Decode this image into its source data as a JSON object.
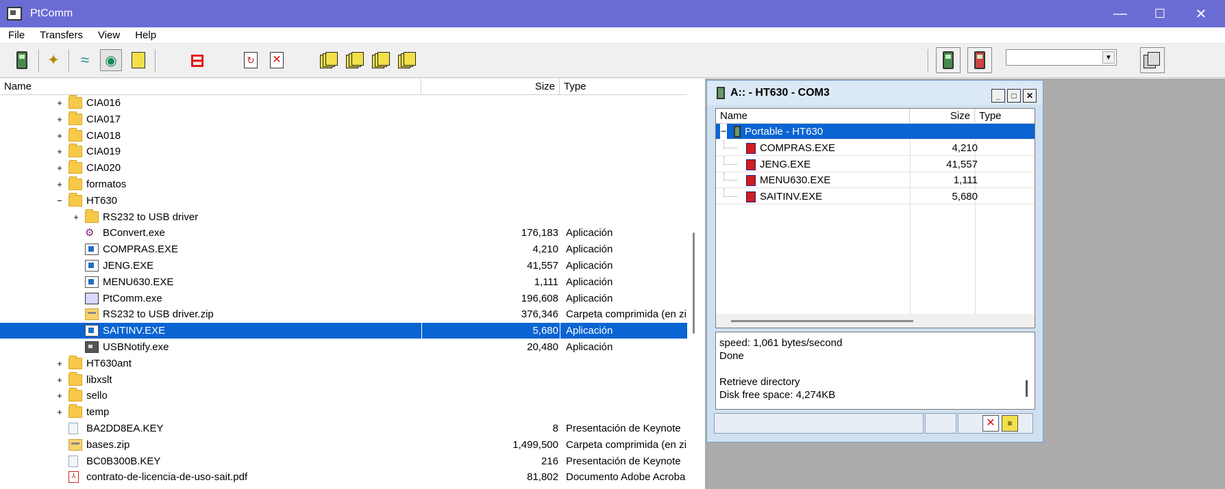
{
  "window": {
    "title": "PtComm",
    "minimize": "—",
    "maximize": "☐",
    "close": "✕"
  },
  "menu": [
    "File",
    "Transfers",
    "View",
    "Help"
  ],
  "toolbar": {
    "icons": [
      "device-icon",
      "wizard-icon",
      "connect-icon",
      "device-find-icon",
      "list-icon",
      "stop-icon",
      "refresh-icon",
      "delete-icon",
      "copy-1-icon",
      "copy-2-icon",
      "copy-3-icon",
      "copy-4-icon",
      "device-send-icon",
      "device-receive-icon",
      "options-icon"
    ],
    "combo_value": ""
  },
  "left_pane": {
    "columns": {
      "name": "Name",
      "size": "Size",
      "type": "Type"
    },
    "rows": [
      {
        "expander": "+",
        "icon": "folder",
        "name": "CIA016",
        "size": "",
        "type": "",
        "level": 0
      },
      {
        "expander": "+",
        "icon": "folder",
        "name": "CIA017",
        "size": "",
        "type": "",
        "level": 0
      },
      {
        "expander": "+",
        "icon": "folder",
        "name": "CIA018",
        "size": "",
        "type": "",
        "level": 0
      },
      {
        "expander": "+",
        "icon": "folder",
        "name": "CIA019",
        "size": "",
        "type": "",
        "level": 0
      },
      {
        "expander": "+",
        "icon": "folder",
        "name": "CIA020",
        "size": "",
        "type": "",
        "level": 0
      },
      {
        "expander": "+",
        "icon": "folder",
        "name": "formatos",
        "size": "",
        "type": "",
        "level": 0
      },
      {
        "expander": "−",
        "icon": "folder",
        "name": "HT630",
        "size": "",
        "type": "",
        "level": 0
      },
      {
        "expander": "+",
        "icon": "folder",
        "name": "RS232 to USB driver",
        "size": "",
        "type": "",
        "level": 1
      },
      {
        "expander": "",
        "icon": "graph",
        "name": "BConvert.exe",
        "size": "176,183",
        "type": "Aplicación",
        "level": 1
      },
      {
        "expander": "",
        "icon": "exe",
        "name": "COMPRAS.EXE",
        "size": "4,210",
        "type": "Aplicación",
        "level": 1
      },
      {
        "expander": "",
        "icon": "exe",
        "name": "JENG.EXE",
        "size": "41,557",
        "type": "Aplicación",
        "level": 1
      },
      {
        "expander": "",
        "icon": "exe",
        "name": "MENU630.EXE",
        "size": "1,111",
        "type": "Aplicación",
        "level": 1
      },
      {
        "expander": "",
        "icon": "pt",
        "name": "PtComm.exe",
        "size": "196,608",
        "type": "Aplicación",
        "level": 1
      },
      {
        "expander": "",
        "icon": "zip",
        "name": "RS232 to USB driver.zip",
        "size": "376,346",
        "type": "Carpeta comprimida (en zi",
        "level": 1
      },
      {
        "expander": "",
        "icon": "exe",
        "name": "SAITINV.EXE",
        "size": "5,680",
        "type": "Aplicación",
        "level": 1,
        "selected": true
      },
      {
        "expander": "",
        "icon": "usb",
        "name": "USBNotify.exe",
        "size": "20,480",
        "type": "Aplicación",
        "level": 1
      },
      {
        "expander": "+",
        "icon": "folder",
        "name": "HT630ant",
        "size": "",
        "type": "",
        "level": 0
      },
      {
        "expander": "+",
        "icon": "folder",
        "name": "libxslt",
        "size": "",
        "type": "",
        "level": 0
      },
      {
        "expander": "+",
        "icon": "folder",
        "name": "sello",
        "size": "",
        "type": "",
        "level": 0
      },
      {
        "expander": "+",
        "icon": "folder",
        "name": "temp",
        "size": "",
        "type": "",
        "level": 0
      },
      {
        "expander": "",
        "icon": "key",
        "name": "BA2DD8EA.KEY",
        "size": "8",
        "type": "Presentación de Keynote",
        "level": 0
      },
      {
        "expander": "",
        "icon": "zip",
        "name": "bases.zip",
        "size": "1,499,500",
        "type": "Carpeta comprimida (en zi",
        "level": 0
      },
      {
        "expander": "",
        "icon": "key",
        "name": "BC0B300B.KEY",
        "size": "216",
        "type": "Presentación de Keynote",
        "level": 0
      },
      {
        "expander": "",
        "icon": "pdf",
        "name": "contrato-de-licencia-de-uso-sait.pdf",
        "size": "81,802",
        "type": "Documento Adobe Acroba",
        "level": 0
      }
    ]
  },
  "device_window": {
    "title": "A:: - HT630 - COM3",
    "controls": {
      "minimize": "_",
      "maximize": "□",
      "close": "✕"
    },
    "columns": {
      "name": "Name",
      "size": "Size",
      "type": "Type"
    },
    "root": {
      "expander": "−",
      "name": "Portable - HT630"
    },
    "files": [
      {
        "name": "COMPRAS.EXE",
        "size": "4,210"
      },
      {
        "name": "JENG.EXE",
        "size": "41,557"
      },
      {
        "name": "MENU630.EXE",
        "size": "1,111"
      },
      {
        "name": "SAITINV.EXE",
        "size": "5,680"
      }
    ],
    "log": [
      "speed: 1,061 bytes/second",
      "Done",
      "",
      "Retrieve directory",
      "Disk free space: 4,274KB"
    ]
  }
}
